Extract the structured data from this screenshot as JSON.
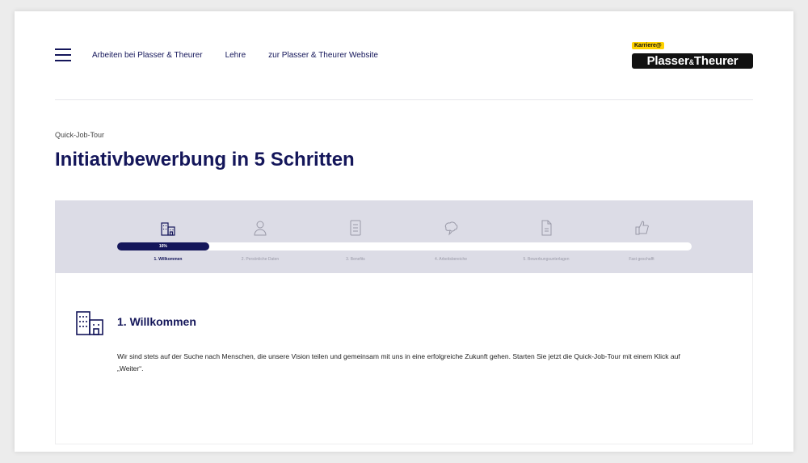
{
  "header": {
    "nav": [
      "Arbeiten bei Plasser & Theurer",
      "Lehre",
      "zur Plasser & Theurer Website"
    ],
    "logo_tag": "Karriere@",
    "logo_word_a": "Plasser",
    "logo_amp": "&",
    "logo_word_b": "Theurer"
  },
  "eyebrow": "Quick-Job-Tour",
  "title": "Initiativbewerbung in 5 Schritten",
  "stepper": {
    "progress_percent": 16,
    "progress_label": "16%",
    "steps": [
      {
        "label": "1. Willkommen",
        "icon": "building-icon",
        "active": true
      },
      {
        "label": "2. Persönliche Daten",
        "icon": "person-icon",
        "active": false
      },
      {
        "label": "3. Benefits",
        "icon": "checklist-icon",
        "active": false
      },
      {
        "label": "4. Arbeitsbereiche",
        "icon": "brain-icon",
        "active": false
      },
      {
        "label": "5. Bewerbungsunterlagen",
        "icon": "document-icon",
        "active": false
      },
      {
        "label": "Fast geschafft",
        "icon": "thumbs-up-icon",
        "active": false
      }
    ]
  },
  "content": {
    "title": "1. Willkommen",
    "text": "Wir sind stets auf der Suche nach Menschen, die unsere Vision teilen und gemeinsam mit uns in eine erfolgreiche Zukunft gehen. Starten Sie jetzt die Quick-Job-Tour mit einem Klick auf „Weiter“."
  },
  "colors": {
    "primary": "#14165a",
    "stepper_bg": "#dcdce6",
    "logo_accent": "#ffd200"
  }
}
